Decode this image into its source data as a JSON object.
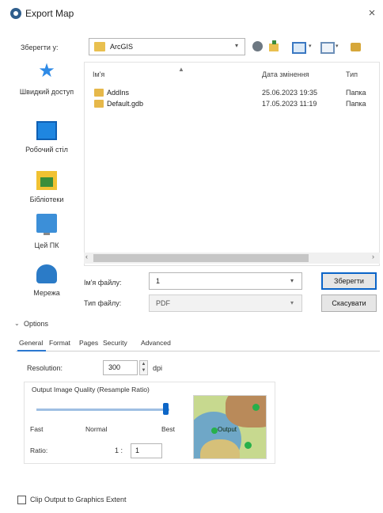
{
  "window": {
    "title": "Export Map",
    "close_glyph": "×"
  },
  "toolbar": {
    "save_in_label": "Зберегти у:",
    "location": "ArcGIS",
    "icons": [
      "back-icon",
      "up-folder-icon",
      "new-folder-icon",
      "view-menu-icon",
      "tools-icon"
    ]
  },
  "places": [
    {
      "label": "Швидкий доступ",
      "icon": "star-icon"
    },
    {
      "label": "Робочий стіл",
      "icon": "desktop-icon"
    },
    {
      "label": "Бібліотеки",
      "icon": "libraries-icon"
    },
    {
      "label": "Цей ПК",
      "icon": "computer-icon"
    },
    {
      "label": "Мережа",
      "icon": "network-icon"
    }
  ],
  "file_list": {
    "columns": {
      "name": "Ім'я",
      "date": "Дата змінення",
      "type": "Тип"
    },
    "rows": [
      {
        "name": "AddIns",
        "date": "25.06.2023 19:35",
        "type": "Папка"
      },
      {
        "name": "Default.gdb",
        "date": "17.05.2023 11:19",
        "type": "Папка"
      }
    ]
  },
  "file_name": {
    "label": "Ім'я файлу:",
    "value": "1"
  },
  "file_type": {
    "label": "Тип файлу:",
    "value": "PDF"
  },
  "buttons": {
    "save": "Зберегти",
    "cancel": "Скасувати"
  },
  "options": {
    "label": "Options",
    "tabs": [
      "General",
      "Format",
      "Pages",
      "Security",
      "Advanced"
    ],
    "active_tab": "General",
    "resolution_label": "Resolution:",
    "resolution_value": "300",
    "resolution_unit": "dpi",
    "quality_title": "Output Image Quality (Resample Ratio)",
    "quality_labels": {
      "fast": "Fast",
      "normal": "Normal",
      "best": "Best"
    },
    "ratio_label": "Ratio:",
    "ratio_prefix": "1 :",
    "ratio_value": "1",
    "preview_label": "Output",
    "clip_label": "Clip Output to Graphics Extent",
    "clip_checked": false
  },
  "colors": {
    "accent": "#0d66c7",
    "folder": "#e6b84a"
  }
}
